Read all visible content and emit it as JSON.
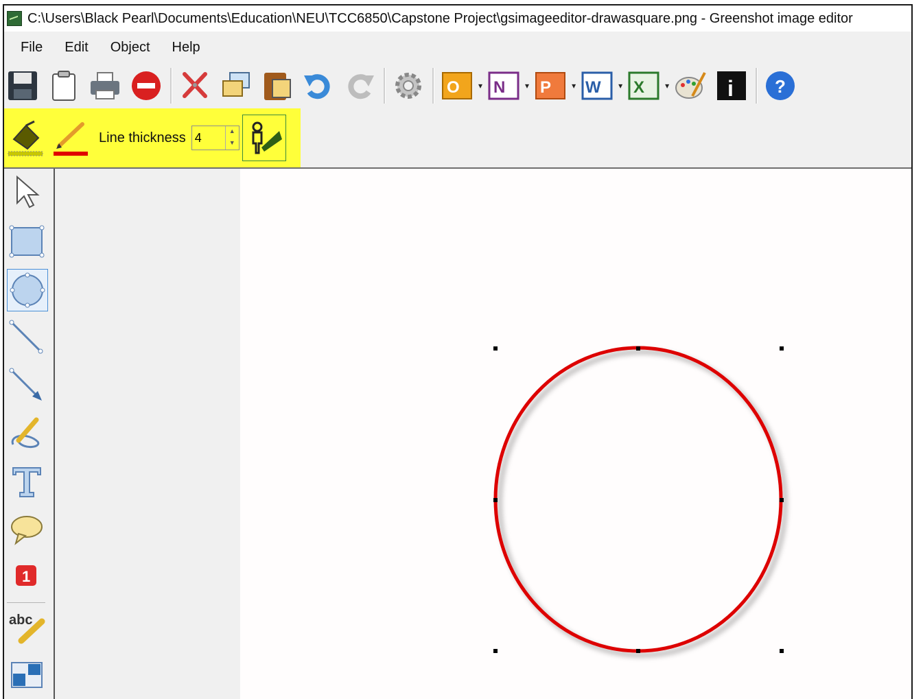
{
  "window": {
    "title": "C:\\Users\\Black Pearl\\Documents\\Education\\NEU\\TCC6850\\Capstone Project\\gsimageeditor-drawasquare.png - Greenshot image editor"
  },
  "menu": {
    "items": [
      {
        "label": "File"
      },
      {
        "label": "Edit"
      },
      {
        "label": "Object"
      },
      {
        "label": "Help"
      }
    ]
  },
  "toolbar": {
    "buttons": [
      {
        "name": "save-icon"
      },
      {
        "name": "clipboard-icon"
      },
      {
        "name": "print-icon"
      },
      {
        "name": "close-editor-icon"
      },
      {
        "name": "cut-icon"
      },
      {
        "name": "copy-icon"
      },
      {
        "name": "paste-icon"
      },
      {
        "name": "undo-icon"
      },
      {
        "name": "redo-icon"
      },
      {
        "name": "settings-gear-icon"
      },
      {
        "name": "outlook-icon",
        "text": "O"
      },
      {
        "name": "onenote-icon",
        "text": "N"
      },
      {
        "name": "powerpoint-icon",
        "text": "P"
      },
      {
        "name": "word-icon",
        "text": "W"
      },
      {
        "name": "excel-icon",
        "text": "X"
      },
      {
        "name": "paint-palette-icon"
      },
      {
        "name": "info-icon",
        "text": "i"
      },
      {
        "name": "help-icon",
        "text": "?"
      }
    ],
    "dropdown_glyph": "▾"
  },
  "properties": {
    "line_thickness_label": "Line thickness",
    "line_thickness_value": "4",
    "fill_color": "#c8c800",
    "line_color": "#e00000",
    "highlight_color": "#ffff3a"
  },
  "tools": [
    {
      "name": "select-tool-icon"
    },
    {
      "name": "rectangle-tool-icon"
    },
    {
      "name": "ellipse-tool-icon",
      "active": true
    },
    {
      "name": "line-tool-icon"
    },
    {
      "name": "arrow-tool-icon"
    },
    {
      "name": "freehand-tool-icon"
    },
    {
      "name": "text-tool-icon"
    },
    {
      "name": "speechbubble-tool-icon"
    },
    {
      "name": "step-label-tool-icon",
      "text": "1"
    },
    {
      "name": "highlight-tool-icon",
      "text": "abc"
    },
    {
      "name": "obfuscate-tool-icon"
    }
  ],
  "canvas": {
    "shape": "ellipse",
    "stroke_color": "#dd0000",
    "selected": true
  }
}
